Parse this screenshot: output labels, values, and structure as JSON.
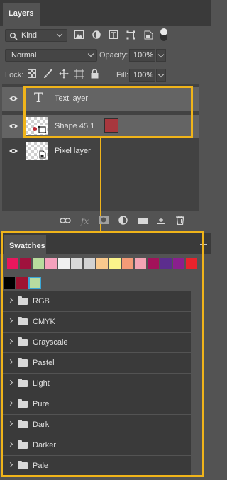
{
  "layers_panel": {
    "tab_label": "Layers",
    "filter": {
      "kind_label": "Kind"
    },
    "blend_mode": "Normal",
    "opacity_label": "Opacity:",
    "opacity_value": "100%",
    "lock_label": "Lock:",
    "fill_label": "Fill:",
    "fill_value": "100%",
    "layers": [
      {
        "name": "Text layer",
        "type": "text",
        "selected": true,
        "visible": true
      },
      {
        "name": "Shape 45 1",
        "type": "shape",
        "selected": true,
        "visible": true,
        "fill_color": "#a8373e"
      },
      {
        "name": "Pixel layer",
        "type": "pixel",
        "selected": false,
        "visible": true
      }
    ],
    "footer_fx_label": "fx"
  },
  "swatches_panel": {
    "tab_label": "Swatches",
    "recent_colors": [
      "#e8175d",
      "#a0123d",
      "#b9dc9e",
      "#f6a1bd",
      "#f0f0f0",
      "#d9d9d9",
      "#d2d2d2",
      "#f9c98d",
      "#fbf38b",
      "#f39b77",
      "#f3a4b4",
      "#a2125a",
      "#5c2d8e",
      "#8a1f8e",
      "#e8232c"
    ],
    "second_row_colors": [
      "#000000",
      "#9e1331",
      "#b7dba0"
    ],
    "groups": [
      "RGB",
      "CMYK",
      "Grayscale",
      "Pastel",
      "Light",
      "Pure",
      "Dark",
      "Darker",
      "Pale"
    ]
  },
  "colors": {
    "highlight": "#f0b41a",
    "panel_bg": "#535353",
    "selected_row": "#646464"
  }
}
